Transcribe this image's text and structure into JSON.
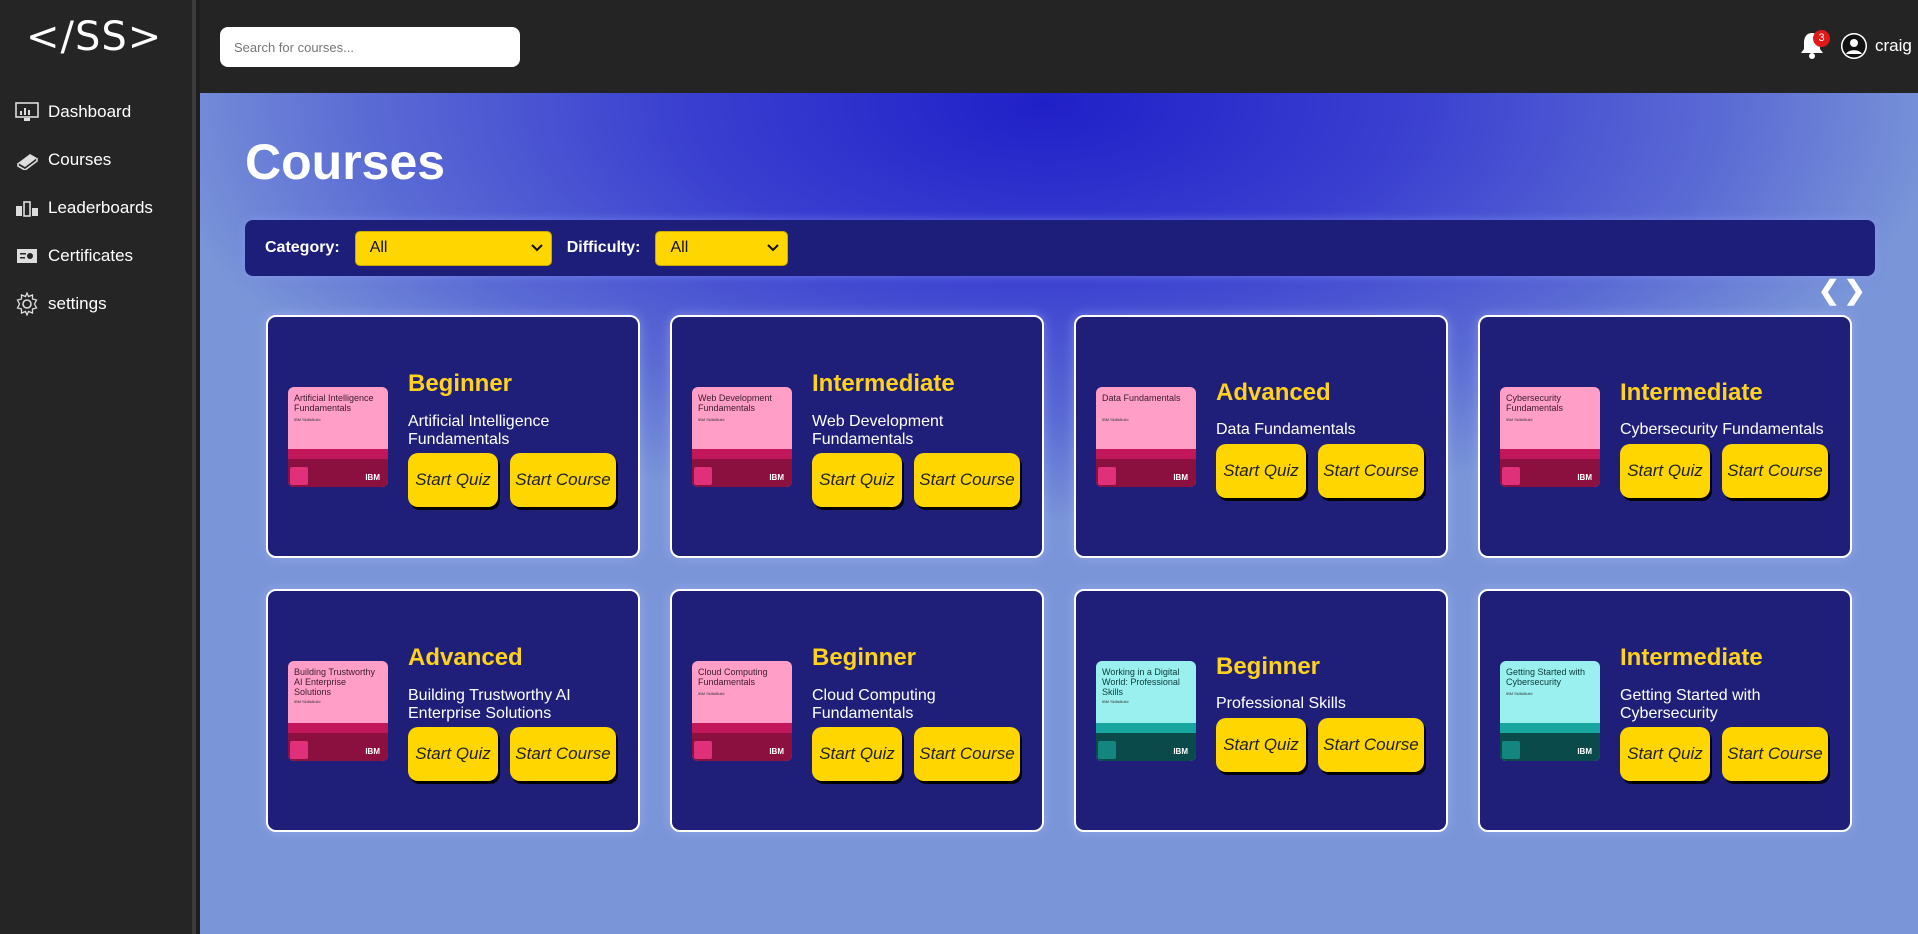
{
  "sidebar": {
    "logo": "</SS>",
    "items": [
      {
        "label": "Dashboard",
        "icon": "dashboard-icon"
      },
      {
        "label": "Courses",
        "icon": "book-icon"
      },
      {
        "label": "Leaderboards",
        "icon": "leaderboard-icon"
      },
      {
        "label": "Certificates",
        "icon": "certificate-icon"
      },
      {
        "label": "settings",
        "icon": "gear-icon"
      }
    ]
  },
  "header": {
    "search_placeholder": "Search for courses...",
    "notification_count": "3",
    "username": "craig"
  },
  "main": {
    "title": "Courses",
    "filters": {
      "category_label": "Category:",
      "category_value": "All",
      "difficulty_label": "Difficulty:",
      "difficulty_value": "All"
    },
    "pager": {
      "prev": "❮",
      "next": "❯"
    },
    "courses": [
      {
        "level": "Beginner",
        "name": "Artificial Intelligence Fundamentals",
        "thumb_title": "Artificial Intelligence Fundamentals",
        "theme": "pink",
        "quiz": "Start Quiz",
        "course": "Start Course"
      },
      {
        "level": "Intermediate",
        "name": "Web Development Fundamentals",
        "thumb_title": "Web Development Fundamentals",
        "theme": "pink",
        "quiz": "Start Quiz",
        "course": "Start Course"
      },
      {
        "level": "Advanced",
        "name": "Data Fundamentals",
        "thumb_title": "Data Fundamentals",
        "theme": "pink",
        "quiz": "Start Quiz",
        "course": "Start Course"
      },
      {
        "level": "Intermediate",
        "name": "Cybersecurity Fundamentals",
        "thumb_title": "Cybersecurity Fundamentals",
        "theme": "pink",
        "quiz": "Start Quiz",
        "course": "Start Course"
      },
      {
        "level": "Advanced",
        "name": "Building Trustworthy AI Enterprise Solutions",
        "thumb_title": "Building Trustworthy AI Enterprise Solutions",
        "theme": "pink",
        "quiz": "Start Quiz",
        "course": "Start Course"
      },
      {
        "level": "Beginner",
        "name": "Cloud Computing Fundamentals",
        "thumb_title": "Cloud Computing Fundamentals",
        "theme": "pink",
        "quiz": "Start Quiz",
        "course": "Start Course"
      },
      {
        "level": "Beginner",
        "name": "Professional Skills",
        "thumb_title": "Working in a Digital World: Professional Skills",
        "theme": "teal",
        "quiz": "Start Quiz",
        "course": "Start Course"
      },
      {
        "level": "Intermediate",
        "name": "Getting Started with Cybersecurity",
        "thumb_title": "Getting Started with Cybersecurity",
        "theme": "teal",
        "quiz": "Start Quiz",
        "course": "Start Course"
      }
    ],
    "thumb_brand": "IBM",
    "thumb_sub": "IBM SkillsBuild"
  },
  "colors": {
    "accent": "#ffd600",
    "level_text": "#ffd21c",
    "card_bg": "#1f1f7a",
    "pink_thumb": "#ff9fc8",
    "teal_thumb": "#9af0ee"
  }
}
